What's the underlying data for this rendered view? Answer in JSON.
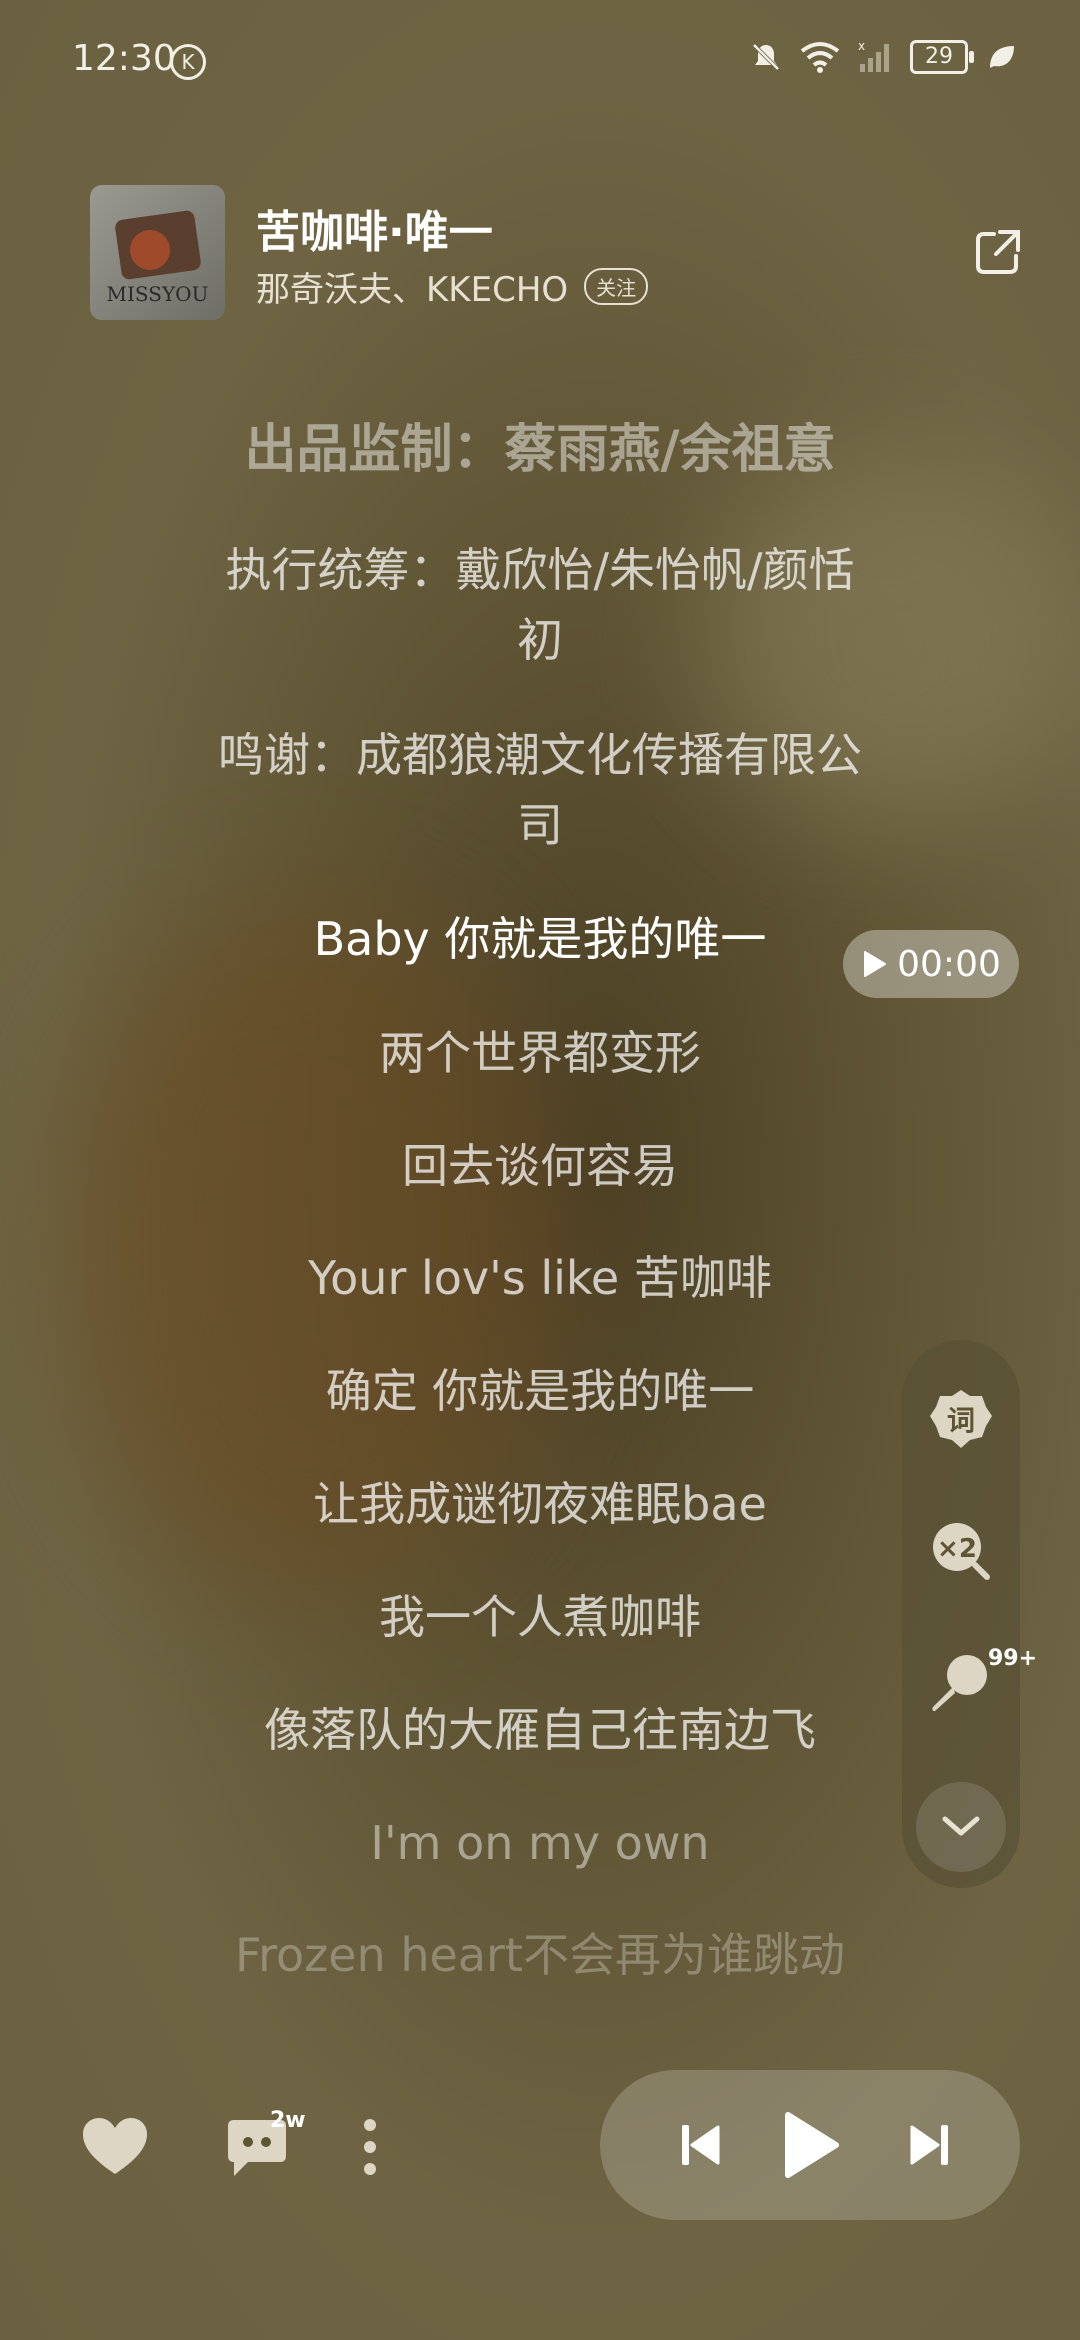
{
  "status_bar": {
    "time": "12:30",
    "k_icon_label": "K",
    "battery": "29",
    "icons": [
      "bell-off-icon",
      "wifi-icon",
      "cellular-icon",
      "battery-icon",
      "leaf-icon"
    ]
  },
  "song": {
    "title": "苦咖啡·唯一",
    "artist": "那奇沃夫、KKECHO",
    "follow_label": "关注",
    "cover_text": "MISSYOU"
  },
  "lyrics": {
    "credit_1": "出品监制：蔡雨燕/余祖意",
    "credit_2": "执行统筹：戴欣怡/朱怡帆/颜恬初",
    "credit_3": "鸣谢：成都狼潮文化传播有限公司",
    "current": "Baby 你就是我的唯一",
    "line_1": "两个世界都变形",
    "line_2": "回去谈何容易",
    "line_3": "Your lov's like 苦咖啡",
    "line_4": "确定 你就是我的唯一",
    "line_5": "让我成谜彻夜难眠bae",
    "line_6": "我一个人煮咖啡",
    "line_7": "像落队的大雁自己往南边飞",
    "line_8": "I'm on my own",
    "line_9": "Frozen heart不会再为谁跳动"
  },
  "time_pill": {
    "label": "00:00"
  },
  "side_panel": {
    "lyrics_button_label": "词",
    "speed_label": "×2",
    "comments_badge": "99+"
  },
  "bottom": {
    "comments_count": "2w"
  },
  "colors": {
    "background": "#5f5433",
    "text_primary": "#ffffff"
  }
}
